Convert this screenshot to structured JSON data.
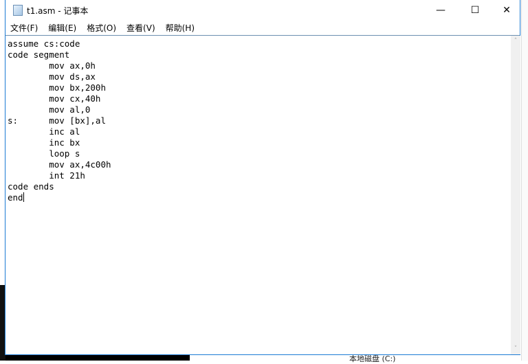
{
  "window": {
    "title": "t1.asm - 记事本",
    "minimize": "—",
    "maximize": "☐",
    "close": "✕"
  },
  "menu": [
    "文件(F)",
    "编辑(E)",
    "格式(O)",
    "查看(V)",
    "帮助(H)"
  ],
  "editor": {
    "content": "assume cs:code\ncode segment\n        mov ax,0h\n        mov ds,ax\n        mov bx,200h\n        mov cx,40h\n        mov al,0\ns:      mov [bx],al\n        inc al\n        inc bx\n        loop s\n        mov ax,4c00h\n        int 21h\ncode ends\nend"
  },
  "background": {
    "drive_label": "本地磁盘 (C:)"
  },
  "scrollbar": {
    "up": "˄",
    "down": "˅"
  }
}
